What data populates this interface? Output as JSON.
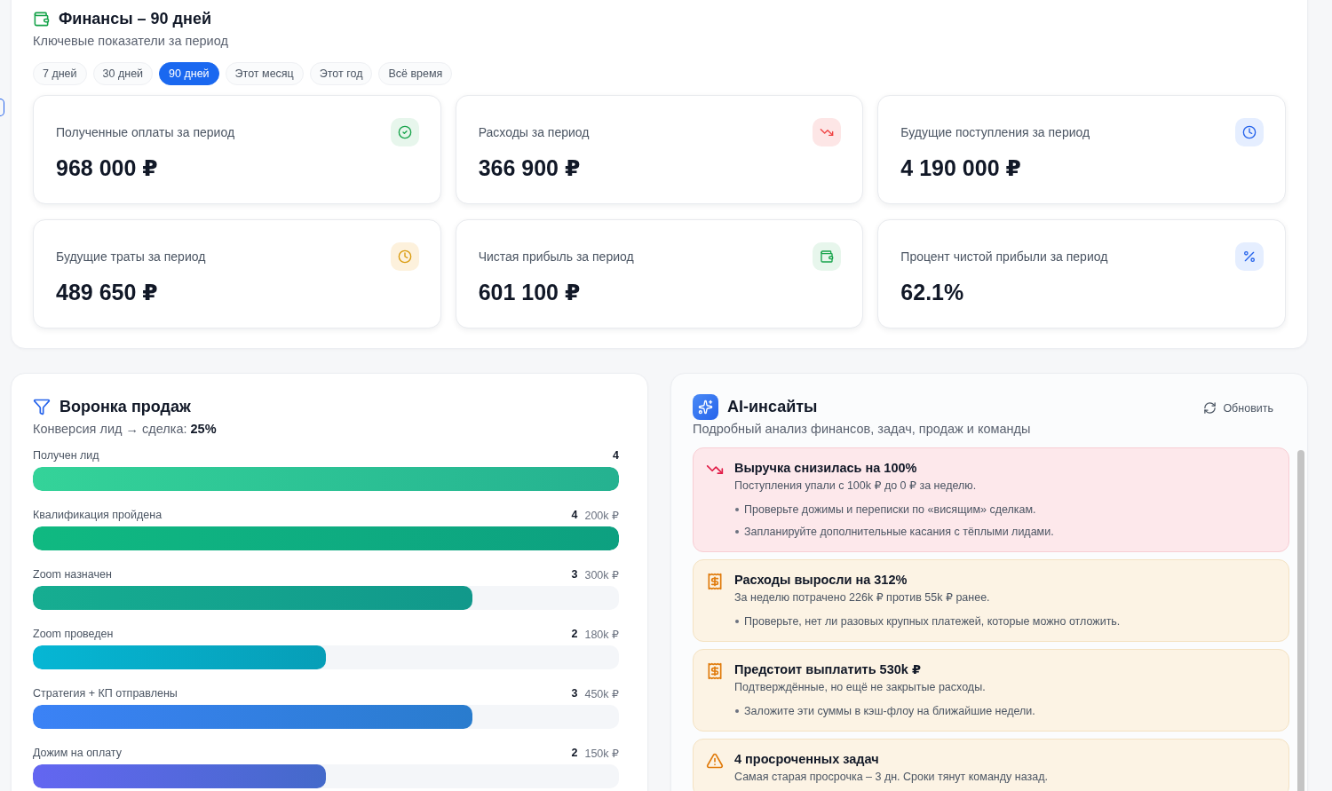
{
  "finance": {
    "title": "Финансы – 90 дней",
    "subtitle": "Ключевые показатели за период",
    "periods": [
      {
        "label": "7 дней",
        "selected": false
      },
      {
        "label": "30 дней",
        "selected": false
      },
      {
        "label": "90 дней",
        "selected": true
      },
      {
        "label": "Этот месяц",
        "selected": false
      },
      {
        "label": "Этот год",
        "selected": false
      },
      {
        "label": "Всё время",
        "selected": false
      }
    ],
    "metrics": [
      {
        "kind": "received",
        "label": "Полученные оплаты за период",
        "value": "968 000 ₽"
      },
      {
        "kind": "expenses",
        "label": "Расходы за период",
        "value": "366 900 ₽"
      },
      {
        "kind": "incoming",
        "label": "Будущие поступления за период",
        "value": "4 190 000 ₽"
      },
      {
        "kind": "upcoming",
        "label": "Будущие траты за период",
        "value": "489 650 ₽"
      },
      {
        "kind": "profit",
        "label": "Чистая прибыль за период",
        "value": "601 100 ₽"
      },
      {
        "kind": "margin",
        "label": "Процент чистой прибыли за период",
        "value": "62.1%"
      }
    ]
  },
  "sales_funnel": {
    "title": "Воронка продаж",
    "conversion": "Конверсия лид → сделка: **25%**",
    "stages": [
      {
        "name": "Получен лид",
        "count": "4",
        "level": 1,
        "color": "#34d399"
      },
      {
        "name": "Квалификация пройдена",
        "count": "4",
        "amount": "200k ₽",
        "level": 1,
        "color": "#10b981"
      },
      {
        "name": "Zoom назначен",
        "count": "3",
        "amount": "300k ₽",
        "level": 0.75,
        "color": "#16ad91"
      },
      {
        "name": "Zoom проведен",
        "count": "2",
        "amount": "180k ₽",
        "level": 0.5,
        "color": "#06b6d4"
      },
      {
        "name": "Стратегия + КП отправлены",
        "count": "3",
        "amount": "450k ₽",
        "level": 0.75,
        "color": "#3b82f6"
      },
      {
        "name": "Дожим на оплату",
        "count": "2",
        "amount": "150k ₽",
        "level": 0.5,
        "color": "#6366f1"
      }
    ]
  },
  "ai_insights": {
    "title": "AI-инсайты",
    "refresh_button": "Обновить",
    "subtitle": "Подробный анализ финансов, задач, продаж и команды",
    "insights": [
      {
        "kind": "revenue",
        "title": "Выручка снизилась на 100%",
        "description": "Поступления упали с 100k ₽ до 0 ₽ за неделю.",
        "tips": [
          "Проверьте дожимы и переписки по «висящим» сделкам.",
          "Запланируйте дополнительные касания с тёплыми лидами."
        ]
      },
      {
        "kind": "expense",
        "title": "Расходы выросли на 312%",
        "description": "За неделю потрачено 226k ₽ против 55k ₽ ранее.",
        "tips": [
          "Проверьте, нет ли разовых крупных платежей, которые можно отложить."
        ]
      },
      {
        "kind": "expense",
        "title": "Предстоит выплатить 530k ₽",
        "description": "Подтверждённые, но ещё не закрытые расходы.",
        "tips": [
          "Заложите эти суммы в кэш-флоу на ближайшие недели."
        ]
      },
      {
        "kind": "tasks",
        "title": "4 просроченных задач",
        "description": "Самая старая просрочка – 3 дн. Сроки тянут команду назад."
      }
    ]
  }
}
